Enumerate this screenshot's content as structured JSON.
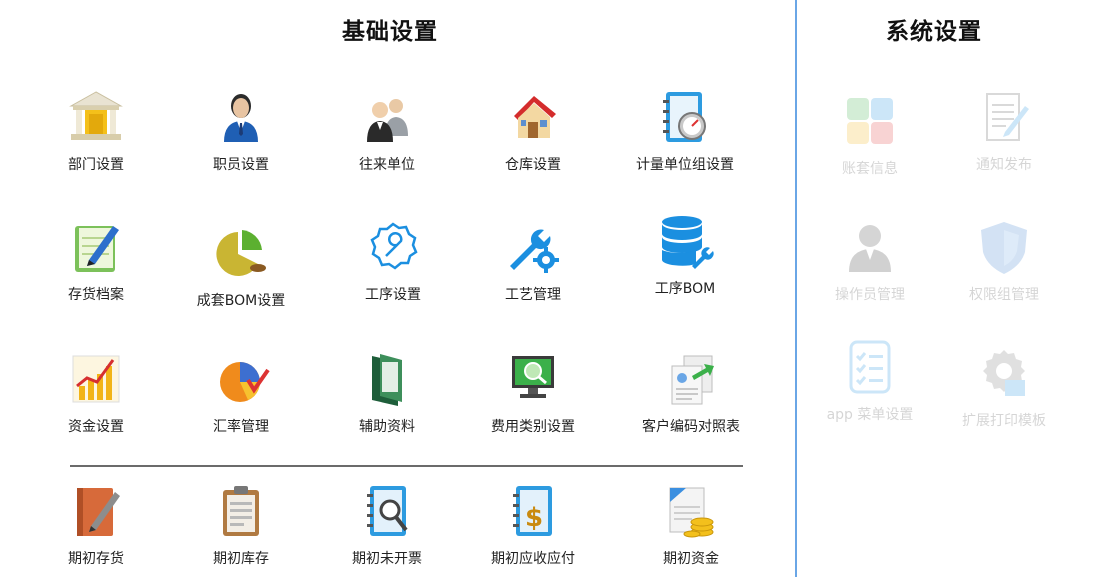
{
  "sections": {
    "basic_title": "基础设置",
    "system_title": "系统设置"
  },
  "basic": {
    "row1": [
      "部门设置",
      "职员设置",
      "往来单位",
      "仓库设置",
      "计量单位组设置"
    ],
    "row2": [
      "存货档案",
      "成套BOM设置",
      "工序设置",
      "工艺管理",
      "工序BOM"
    ],
    "row3": [
      "资金设置",
      "汇率管理",
      "辅助资料",
      "费用类别设置",
      "客户编码对照表"
    ],
    "row4": [
      "期初存货",
      "期初库存",
      "期初未开票",
      "期初应收应付",
      "期初资金"
    ]
  },
  "system": {
    "items": [
      "账套信息",
      "通知发布",
      "操作员管理",
      "权限组管理",
      "app 菜单设置",
      "扩展打印模板"
    ]
  },
  "colors": {
    "divider_blue": "#6aa6e6",
    "accent_blue": "#1b8fe0"
  }
}
